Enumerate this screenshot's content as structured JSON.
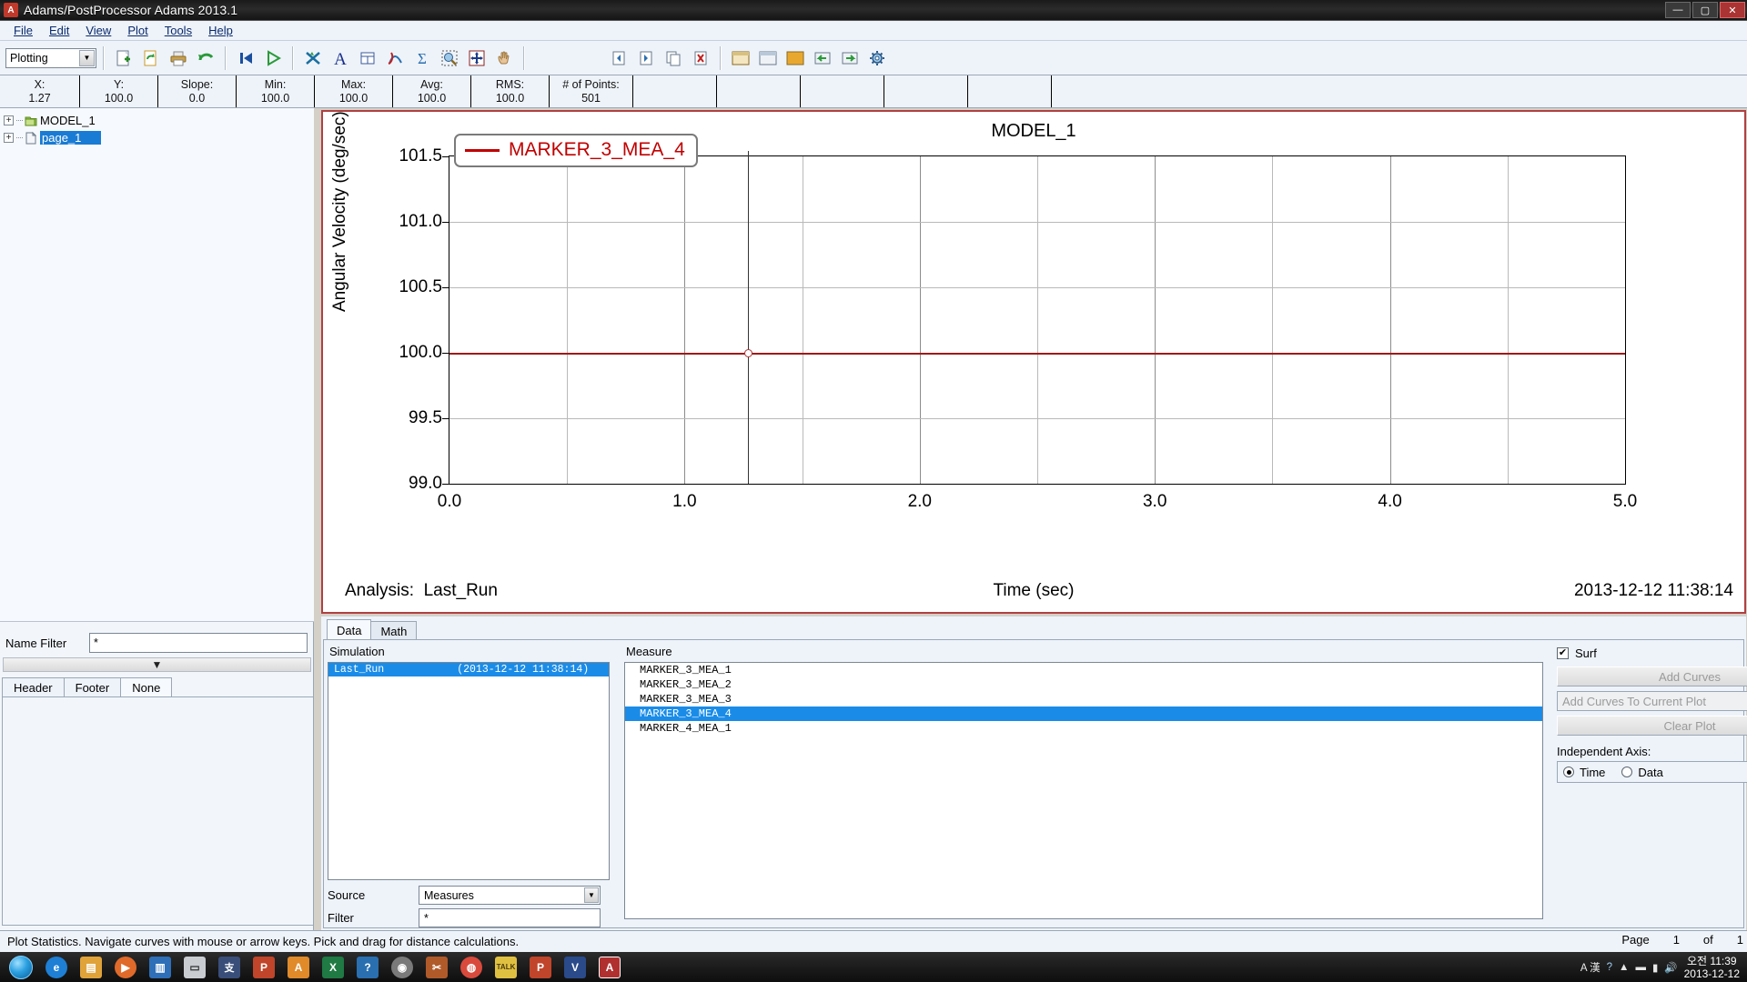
{
  "window": {
    "title": "Adams/PostProcessor Adams 2013.1",
    "app_icon": "A",
    "minimize": "—",
    "maximize": "▢",
    "close": "✕"
  },
  "menu": {
    "items": [
      {
        "label": "File"
      },
      {
        "label": "Edit"
      },
      {
        "label": "View"
      },
      {
        "label": "Plot"
      },
      {
        "label": "Tools"
      },
      {
        "label": "Help"
      }
    ]
  },
  "toolbar": {
    "mode_selected": "Plotting",
    "buttons": [
      {
        "name": "new-page-icon",
        "title": "New Page"
      },
      {
        "name": "reload-icon",
        "title": "Reload"
      },
      {
        "name": "print-icon",
        "title": "Print"
      },
      {
        "name": "undo-icon",
        "title": "Undo"
      },
      {
        "name": "first-frame-icon",
        "title": "First Frame"
      },
      {
        "name": "play-icon",
        "title": "Play"
      },
      {
        "name": "clear-plot-icon",
        "title": "Clear Plot"
      },
      {
        "name": "text-tool-icon",
        "title": "Text"
      },
      {
        "name": "table-icon",
        "title": "Table"
      },
      {
        "name": "curve-stats-icon",
        "title": "Curve Stats"
      },
      {
        "name": "sigma-icon",
        "title": "Sum"
      },
      {
        "name": "zoom-select-icon",
        "title": "Zoom Select"
      },
      {
        "name": "fit-icon",
        "title": "Fit"
      },
      {
        "name": "pan-hand-icon",
        "title": "Pan"
      },
      {
        "name": "prev-page-icon",
        "title": "Previous Page"
      },
      {
        "name": "next-page-icon",
        "title": "Next Page"
      },
      {
        "name": "copy-page-icon",
        "title": "Copy Page"
      },
      {
        "name": "delete-page-icon",
        "title": "Delete Page"
      },
      {
        "name": "layout-1-icon",
        "title": "Layout One"
      },
      {
        "name": "layout-2-icon",
        "title": "Layout Two"
      },
      {
        "name": "layout-3-icon",
        "title": "Layout Three"
      },
      {
        "name": "arrange-left-icon",
        "title": "Arrange Left"
      },
      {
        "name": "arrange-right-icon",
        "title": "Arrange Right"
      },
      {
        "name": "settings-gear-icon",
        "title": "Settings"
      }
    ]
  },
  "statistics": [
    {
      "label": "X:",
      "value": "1.27"
    },
    {
      "label": "Y:",
      "value": "100.0"
    },
    {
      "label": "Slope:",
      "value": "0.0"
    },
    {
      "label": "Min:",
      "value": "100.0"
    },
    {
      "label": "Max:",
      "value": "100.0"
    },
    {
      "label": "Avg:",
      "value": "100.0"
    },
    {
      "label": "RMS:",
      "value": "100.0"
    },
    {
      "label": "# of Points:",
      "value": "501"
    }
  ],
  "tree": {
    "nodes": [
      {
        "label": "MODEL_1",
        "selected": false,
        "icon": "model-folder-icon"
      },
      {
        "label": "page_1",
        "selected": true,
        "icon": "page-icon"
      }
    ]
  },
  "name_filter": {
    "label": "Name Filter",
    "value": "*"
  },
  "header_tabs": {
    "items": [
      {
        "label": "Header",
        "active": false
      },
      {
        "label": "Footer",
        "active": false
      },
      {
        "label": "None",
        "active": true
      }
    ]
  },
  "plot": {
    "title": "MODEL_1",
    "analysis_label": "Analysis:",
    "analysis_value": "Last_Run",
    "datestamp": "2013-12-12 11:38:14",
    "legend": "MARKER_3_MEA_4",
    "legend_color": "#c00000",
    "curve_color": "#a01818",
    "border_color": "#b04040"
  },
  "chart_data": {
    "type": "line",
    "title": "MODEL_1",
    "xlabel": "Time (sec)",
    "ylabel": "Angular Velocity (deg/sec)",
    "xlim": [
      0.0,
      5.0
    ],
    "ylim": [
      99.0,
      101.5
    ],
    "xticks": [
      "0.0",
      "1.0",
      "2.0",
      "3.0",
      "4.0",
      "5.0"
    ],
    "xtick_values": [
      0.0,
      1.0,
      2.0,
      3.0,
      4.0,
      5.0
    ],
    "yticks": [
      "99.0",
      "99.5",
      "100.0",
      "100.5",
      "101.0",
      "101.5"
    ],
    "ytick_values": [
      99.0,
      99.5,
      100.0,
      100.5,
      101.0,
      101.5
    ],
    "grid": true,
    "legend_position": "upper-left",
    "n_points": 501,
    "cursor": {
      "x": 1.27,
      "y": 100.0
    },
    "series": [
      {
        "name": "MARKER_3_MEA_4",
        "color": "#a01818",
        "x": [
          0.0,
          0.5,
          1.0,
          1.5,
          2.0,
          2.5,
          3.0,
          3.5,
          4.0,
          4.5,
          5.0
        ],
        "values": [
          100.0,
          100.0,
          100.0,
          100.0,
          100.0,
          100.0,
          100.0,
          100.0,
          100.0,
          100.0,
          100.0
        ],
        "min": 100.0,
        "max": 100.0,
        "avg": 100.0,
        "rms": 100.0,
        "slope": 0.0
      }
    ]
  },
  "data_panel": {
    "tabs": [
      {
        "label": "Data",
        "active": true
      },
      {
        "label": "Math",
        "active": false
      }
    ],
    "simulation_label": "Simulation",
    "simulations": [
      {
        "name": "Last_Run",
        "time": "(2013-12-12 11:38:14)",
        "selected": true
      }
    ],
    "measure_label": "Measure",
    "measures": [
      {
        "name": "MARKER_3_MEA_1",
        "selected": false
      },
      {
        "name": "MARKER_3_MEA_2",
        "selected": false
      },
      {
        "name": "MARKER_3_MEA_3",
        "selected": false
      },
      {
        "name": "MARKER_3_MEA_4",
        "selected": true
      },
      {
        "name": "MARKER_4_MEA_1",
        "selected": false
      }
    ],
    "source_label": "Source",
    "source_value": "Measures",
    "filter_label": "Filter",
    "filter_value": "*"
  },
  "right_controls": {
    "surf_label": "Surf",
    "surf_checked": true,
    "surf_check_glyph": "✔",
    "add_curves_label": "Add Curves",
    "add_curves_to_plot_label": "Add Curves To Current Plot",
    "clear_plot_label": "Clear Plot",
    "independent_axis_label": "Independent Axis:",
    "axis_options": [
      {
        "label": "Time",
        "selected": true
      },
      {
        "label": "Data",
        "selected": false
      }
    ]
  },
  "statusbar": {
    "message": "Plot Statistics.  Navigate curves with mouse or arrow keys.  Pick and drag for distance calculations.",
    "page_label": "Page",
    "page_current": "1",
    "page_of": "of",
    "page_total": "1"
  },
  "taskbar": {
    "start_name": "start-orb",
    "items": [
      {
        "name": "internet-explorer-icon",
        "glyph": "e",
        "color": "#1e7fd4"
      },
      {
        "name": "folder-explorer-icon",
        "glyph": "▤",
        "color": "#e0a33a"
      },
      {
        "name": "media-player-icon",
        "glyph": "▶",
        "color": "#e06a2a"
      },
      {
        "name": "window-app-icon",
        "glyph": "▥",
        "color": "#2e6fb8"
      },
      {
        "name": "notepad-icon",
        "glyph": "▭",
        "color": "#c9cdd2"
      },
      {
        "name": "chinese-app-icon",
        "glyph": "支",
        "color": "#3a4e7a"
      },
      {
        "name": "powerpoint-icon",
        "glyph": "P",
        "color": "#c0452a"
      },
      {
        "name": "autodesk-icon",
        "glyph": "A",
        "color": "#e08a2a"
      },
      {
        "name": "excel-icon",
        "glyph": "X",
        "color": "#1f7a44"
      },
      {
        "name": "help-app-icon",
        "glyph": "?",
        "color": "#2a6fb0"
      },
      {
        "name": "disc-app-icon",
        "glyph": "◉",
        "color": "#7a7a7a"
      },
      {
        "name": "scissors-icon",
        "glyph": "✂",
        "color": "#b05a2a"
      },
      {
        "name": "chrome-icon",
        "glyph": "◍",
        "color": "#d94a3d"
      },
      {
        "name": "kakaotalk-icon",
        "glyph": "TALK",
        "color": "#e0c040"
      },
      {
        "name": "powerpoint2-icon",
        "glyph": "P",
        "color": "#c0452a"
      },
      {
        "name": "visio-icon",
        "glyph": "V",
        "color": "#2a4a8a"
      },
      {
        "name": "adams-icon",
        "glyph": "A",
        "color": "#b03030"
      }
    ],
    "tray": {
      "ime_label": "A 漢",
      "clock_time": "오전 11:39",
      "clock_date": "2013-12-12"
    }
  }
}
